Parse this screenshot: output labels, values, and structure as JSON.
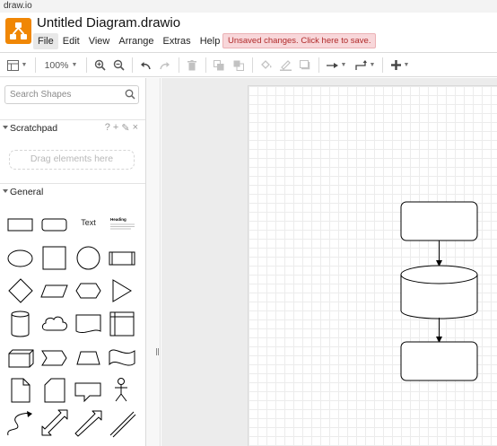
{
  "browser": {
    "tab_label": "draw.io"
  },
  "app": {
    "title": "Untitled Diagram.drawio",
    "unsaved_notice": "Unsaved changes. Click here to save.",
    "accent_color": "#f08705"
  },
  "menu": {
    "items": [
      "File",
      "Edit",
      "View",
      "Arrange",
      "Extras",
      "Help"
    ],
    "active": "File"
  },
  "toolbar": {
    "zoom": "100%",
    "icons": [
      "format-panel-icon",
      "zoom-in-icon",
      "zoom-out-icon",
      "undo-icon",
      "redo-icon",
      "delete-icon",
      "to-front-icon",
      "to-back-icon",
      "fill-color-icon",
      "line-color-icon",
      "shadow-icon",
      "connection-icon",
      "waypoints-icon",
      "insert-icon"
    ]
  },
  "sidebar": {
    "search_placeholder": "Search Shapes",
    "scratchpad": {
      "label": "Scratchpad",
      "help": "?",
      "add": "+",
      "edit": "✎",
      "close": "×",
      "drop_hint": "Drag elements here"
    },
    "general": {
      "label": "General",
      "text_shape": "Text",
      "heading_shape": "Heading",
      "shapes": [
        "rectangle",
        "rounded-rectangle",
        "text",
        "textbox",
        "ellipse",
        "square",
        "circle",
        "process",
        "diamond",
        "parallelogram",
        "hexagon",
        "triangle",
        "cylinder",
        "cloud",
        "document",
        "internal-storage",
        "cube",
        "step",
        "trapezoid",
        "tape",
        "note",
        "card",
        "callout",
        "actor",
        "curve",
        "bidirectional-arrow",
        "arrow",
        "line"
      ]
    }
  },
  "diagram": {
    "nodes": [
      "rounded-rectangle",
      "cylinder",
      "rounded-rectangle"
    ],
    "edges": [
      [
        "node-1",
        "node-2"
      ],
      [
        "node-2",
        "node-3"
      ]
    ]
  }
}
